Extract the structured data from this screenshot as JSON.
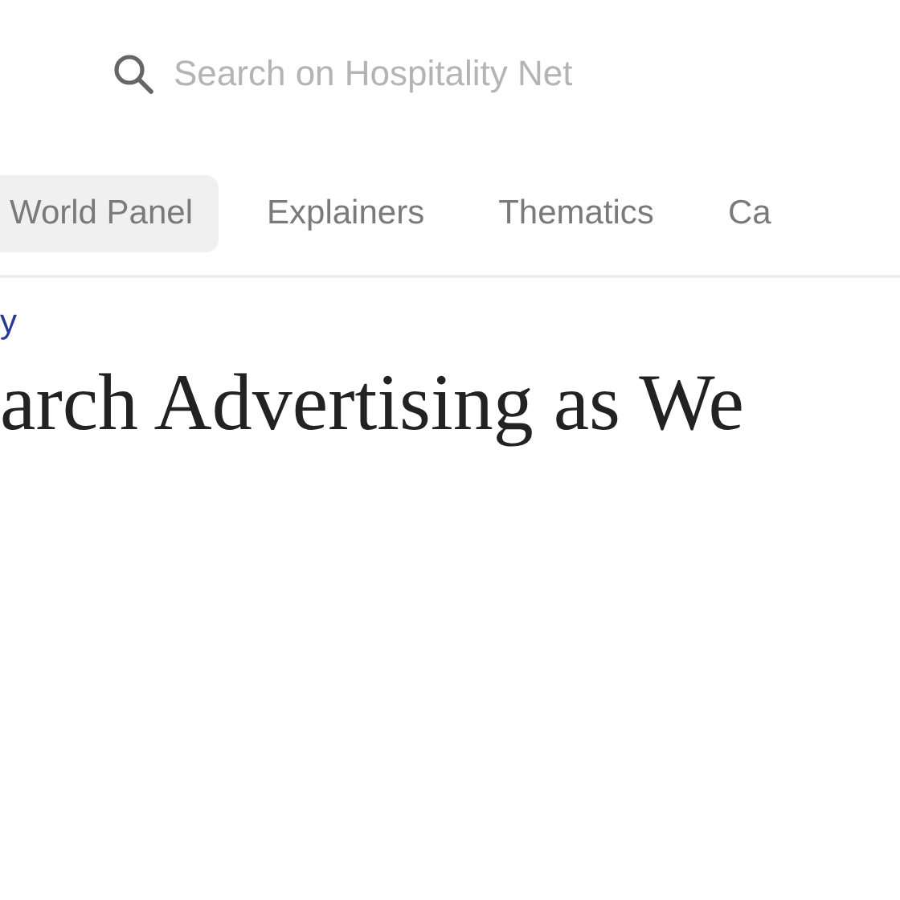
{
  "search": {
    "placeholder": "Search on Hospitality Net"
  },
  "nav_tabs": [
    {
      "label": "World Panel",
      "selected": true
    },
    {
      "label": "Explainers",
      "selected": false
    },
    {
      "label": "Thematics",
      "selected": false
    },
    {
      "label": "Ca",
      "selected": false
    }
  ],
  "category_link": "y",
  "headline": "arch Advertising as We"
}
